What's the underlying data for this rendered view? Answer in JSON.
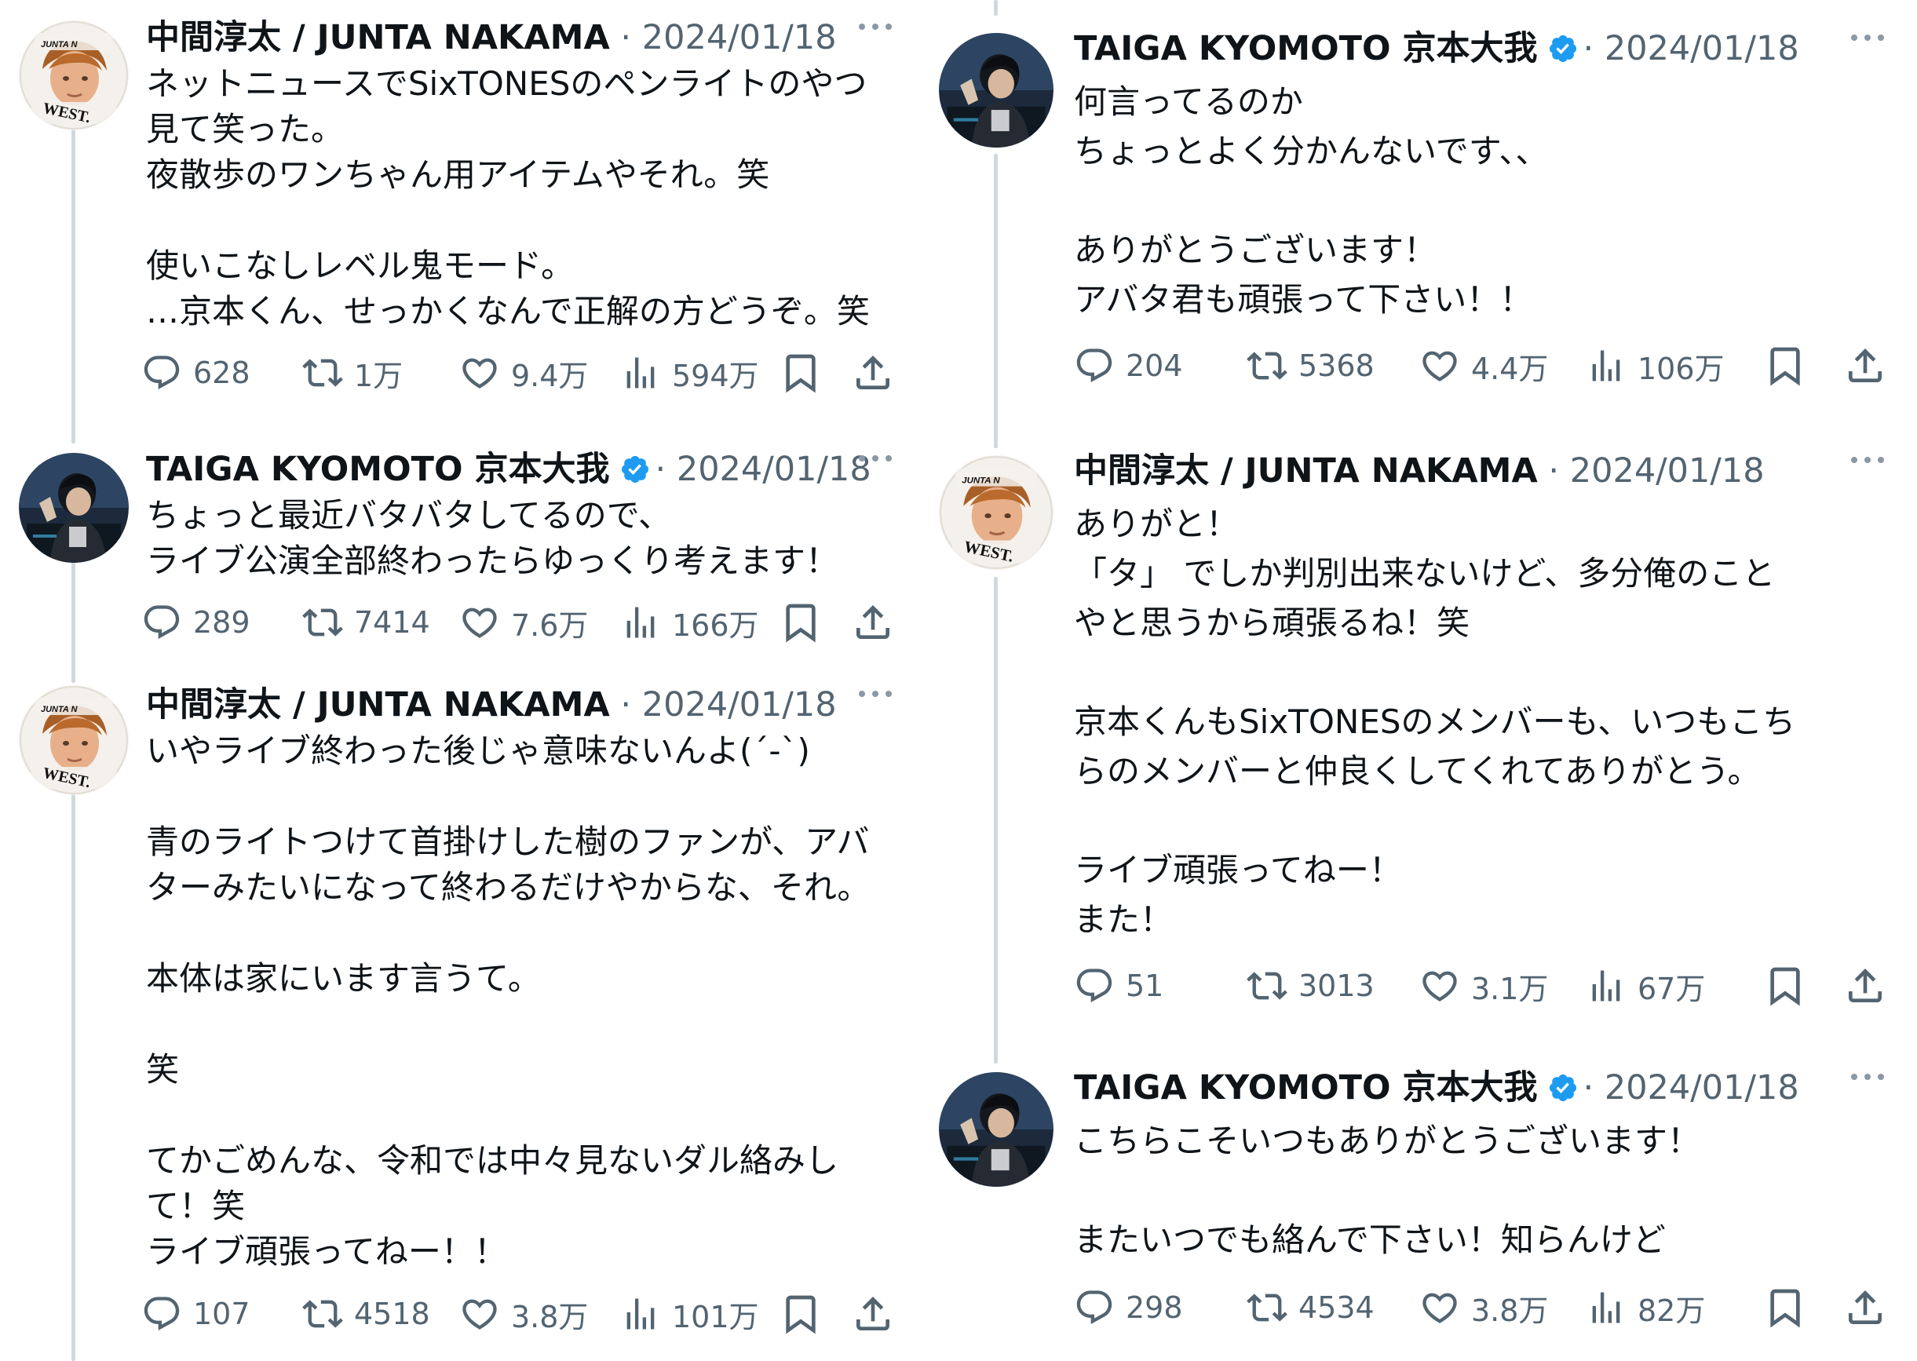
{
  "users": {
    "junta": {
      "name": "中間淳太 / JUNTA NAKAMA",
      "avatar_badge_top": "JUNTA N",
      "avatar_badge_bottom": "WEST."
    },
    "taiga": {
      "name": "TAIGA KYOMOTO 京本大我",
      "verified": true
    }
  },
  "separator": "·",
  "left_tweets": [
    {
      "date": "2024/01/18",
      "text": "ネットニュースでSixTONESのペンライトのやつ\n見て笑った。\n夜散歩のワンちゃん用アイテムやそれ。笑\n\n使いこなしレベル鬼モード。\n…京本くん、せっかくなんで正解の方どうぞ。笑",
      "replies": "628",
      "retweets": "1万",
      "likes": "9.4万",
      "views": "594万"
    },
    {
      "date": "2024/01/18",
      "text": "ちょっと最近バタバタしてるので、\nライブ公演全部終わったらゆっくり考えます！",
      "replies": "289",
      "retweets": "7414",
      "likes": "7.6万",
      "views": "166万"
    },
    {
      "date": "2024/01/18",
      "text": "いやライブ終わった後じゃ意味ないんよ(´-`)\n\n青のライトつけて首掛けした樹のファンが、アバ\nターみたいになって終わるだけやからな、それ。\n\n本体は家にいます言うて。\n\n笑\n\nてかごめんな、令和では中々見ないダル絡みし\nて！笑\nライブ頑張ってねー！！",
      "replies": "107",
      "retweets": "4518",
      "likes": "3.8万",
      "views": "101万"
    }
  ],
  "right_tweets": [
    {
      "date": "2024/01/18",
      "text": "何言ってるのか\nちょっとよく分かんないです、、\n\nありがとうございます！\nアバタ君も頑張って下さい！！",
      "replies": "204",
      "retweets": "5368",
      "likes": "4.4万",
      "views": "106万"
    },
    {
      "date": "2024/01/18",
      "text": "ありがと！\n「タ」 でしか判別出来ないけど、多分俺のこと\nやと思うから頑張るね！笑\n\n京本くんもSixTONESのメンバーも、いつもこち\nらのメンバーと仲良くしてくれてありがとう。\n\nライブ頑張ってねー！\nまた！",
      "replies": "51",
      "retweets": "3013",
      "likes": "3.1万",
      "views": "67万"
    },
    {
      "date": "2024/01/18",
      "text": "こちらこそいつもありがとうございます！\n\nまたいつでも絡んで下さい！知らんけど",
      "replies": "298",
      "retweets": "4534",
      "likes": "3.8万",
      "views": "82万"
    }
  ],
  "icons": [
    "reply-icon",
    "retweet-icon",
    "like-icon",
    "views-icon",
    "bookmark-icon",
    "share-icon",
    "more-icon",
    "verified-badge-icon"
  ],
  "colors": {
    "text": "#0f1419",
    "secondary": "#536471",
    "verified": "#1d9bf0",
    "thread_line": "#cfd9de"
  }
}
